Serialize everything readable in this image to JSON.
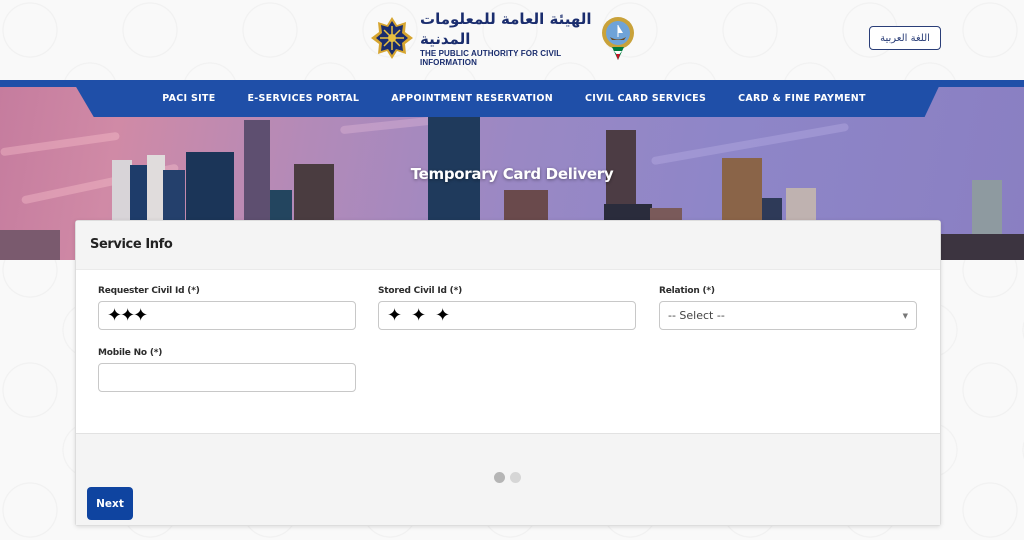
{
  "header": {
    "logo_arabic": "الهيئة العامة للمعلومات المدنية",
    "logo_english": "THE PUBLIC AUTHORITY FOR CIVIL INFORMATION",
    "language_button": "اللغة العربية"
  },
  "nav": {
    "items": [
      {
        "label": "PACI SITE"
      },
      {
        "label": "E-SERVICES PORTAL"
      },
      {
        "label": "APPOINTMENT RESERVATION"
      },
      {
        "label": "CIVIL CARD SERVICES"
      },
      {
        "label": "CARD & FINE PAYMENT"
      }
    ]
  },
  "banner": {
    "title": "Temporary Card Delivery"
  },
  "form": {
    "section_title": "Service Info",
    "fields": {
      "requester_civil_id": {
        "label": "Requester Civil Id (*)",
        "value": "✦✦✦"
      },
      "stored_civil_id": {
        "label": "Stored Civil Id (*)",
        "value": "✦ ✦ ✦"
      },
      "relation": {
        "label": "Relation (*)",
        "selected": "-- Select --"
      },
      "mobile_no": {
        "label": "Mobile No (*)",
        "value": ""
      }
    },
    "steps": {
      "total": 2,
      "current": 1
    },
    "next_button": "Next"
  },
  "colors": {
    "brand_blue": "#1f4fa8",
    "button_blue": "#0f44a0",
    "logo_navy": "#1a2d6e"
  }
}
